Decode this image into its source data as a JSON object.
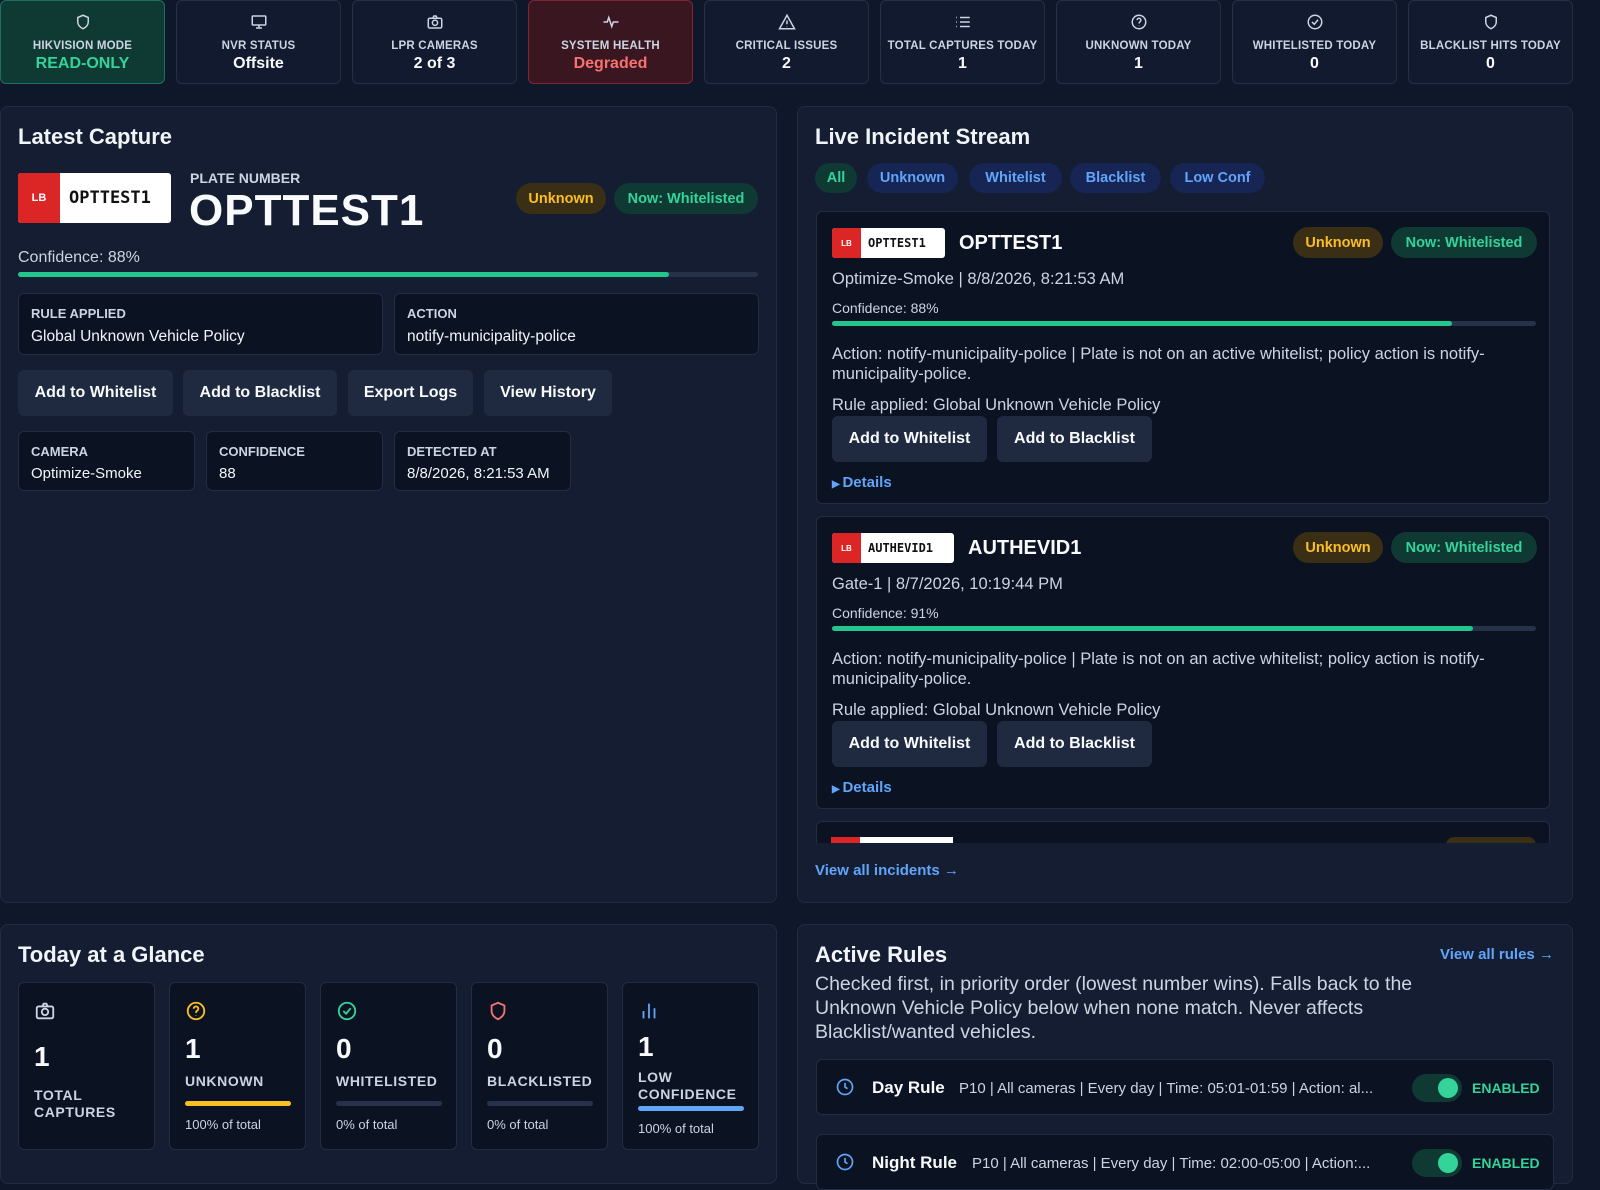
{
  "topbar": [
    {
      "label": "HIKVISION MODE",
      "value": "READ-ONLY",
      "icon": "shield-icon"
    },
    {
      "label": "NVR STATUS",
      "value": "Offsite",
      "icon": "monitor-icon"
    },
    {
      "label": "LPR CAMERAS",
      "value": "2 of 3",
      "icon": "camera-icon"
    },
    {
      "label": "SYSTEM HEALTH",
      "value": "Degraded",
      "icon": "pulse-icon"
    },
    {
      "label": "CRITICAL ISSUES",
      "value": "2",
      "icon": "warning-icon"
    },
    {
      "label": "TOTAL CAPTURES TODAY",
      "value": "1",
      "icon": "list-icon"
    },
    {
      "label": "UNKNOWN TODAY",
      "value": "1",
      "icon": "question-icon"
    },
    {
      "label": "WHITELISTED TODAY",
      "value": "0",
      "icon": "check-circle-icon"
    },
    {
      "label": "BLACKLIST HITS TODAY",
      "value": "0",
      "icon": "shield-icon"
    }
  ],
  "latest": {
    "title": "Latest Capture",
    "plate_flag": "LB",
    "plate_text": "OPTTEST1",
    "plate_number_label": "PLATE NUMBER",
    "plate_number": "OPTTEST1",
    "badge_status": "Unknown",
    "badge_now": "Now: Whitelisted",
    "confidence_text": "Confidence: 88%",
    "confidence": 0.88,
    "rule_label": "RULE APPLIED",
    "rule_value": "Global Unknown Vehicle Policy",
    "action_label": "ACTION",
    "action_value": "notify-municipality-police",
    "buttons": [
      "Add to Whitelist",
      "Add to Blacklist",
      "Export Logs",
      "View History"
    ],
    "camera_label": "CAMERA",
    "camera_value": "Optimize-Smoke",
    "conf_label": "CONFIDENCE",
    "conf_value": "88",
    "detected_label": "DETECTED AT",
    "detected_value": "8/8/2026, 8:21:53 AM"
  },
  "stream": {
    "title": "Live Incident Stream",
    "filters": [
      "All",
      "Unknown",
      "Whitelist",
      "Blacklist",
      "Low Conf"
    ],
    "incidents": [
      {
        "flag": "LB",
        "plate": "OPTTEST1",
        "title": "OPTTEST1",
        "status": "Unknown",
        "now": "Now: Whitelisted",
        "meta": "Optimize-Smoke | 8/8/2026, 8:21:53 AM",
        "conf_text": "Confidence: 88%",
        "conf": 0.88,
        "action": "Action: notify-municipality-police | Plate is not on an active whitelist; policy action is notify-municipality-police.",
        "rule": "Rule applied: Global Unknown Vehicle Policy",
        "btn_wl": "Add to Whitelist",
        "btn_bl": "Add to Blacklist",
        "details": "Details"
      },
      {
        "flag": "LB",
        "plate": "AUTHEVID1",
        "title": "AUTHEVID1",
        "status": "Unknown",
        "now": "Now: Whitelisted",
        "meta": "Gate-1 | 8/7/2026, 10:19:44 PM",
        "conf_text": "Confidence: 91%",
        "conf": 0.91,
        "action": "Action: notify-municipality-police | Plate is not on an active whitelist; policy action is notify-municipality-police.",
        "rule": "Rule applied: Global Unknown Vehicle Policy",
        "btn_wl": "Add to Whitelist",
        "btn_bl": "Add to Blacklist",
        "details": "Details"
      }
    ],
    "view_all": "View all incidents →"
  },
  "glance": {
    "title": "Today at a Glance",
    "cards": [
      {
        "value": "1",
        "label": "TOTAL CAPTURES",
        "icon": "camera-icon"
      },
      {
        "value": "1",
        "label": "UNKNOWN",
        "pct_text": "100% of total",
        "pct": 1.0,
        "color": "#fbbf24",
        "icon": "question-icon"
      },
      {
        "value": "0",
        "label": "WHITELISTED",
        "pct_text": "0% of total",
        "pct": 0,
        "color": "#34d399",
        "icon": "check-circle-icon"
      },
      {
        "value": "0",
        "label": "BLACKLISTED",
        "pct_text": "0% of total",
        "pct": 0,
        "color": "#f87171",
        "icon": "shield-icon"
      },
      {
        "value": "1",
        "label": "LOW",
        "label2": "CONFIDENCE",
        "pct_text": "100% of total",
        "pct": 1.0,
        "color": "#60a5fa",
        "icon": "bar-chart-icon"
      }
    ]
  },
  "rules": {
    "title": "Active Rules",
    "view_all": "View all rules →",
    "description": "Checked first, in priority order (lowest number wins). Falls back to the Unknown Vehicle Policy below when none match. Never affects Blacklist/wanted vehicles.",
    "items": [
      {
        "name": "Day Rule",
        "desc": "P10 | All cameras | Every day | Time: 05:01-01:59 | Action: al...",
        "status": "ENABLED"
      },
      {
        "name": "Night Rule",
        "desc": "P10 | All cameras | Every day | Time: 02:00-05:00 | Action:...",
        "status": "ENABLED"
      }
    ]
  }
}
